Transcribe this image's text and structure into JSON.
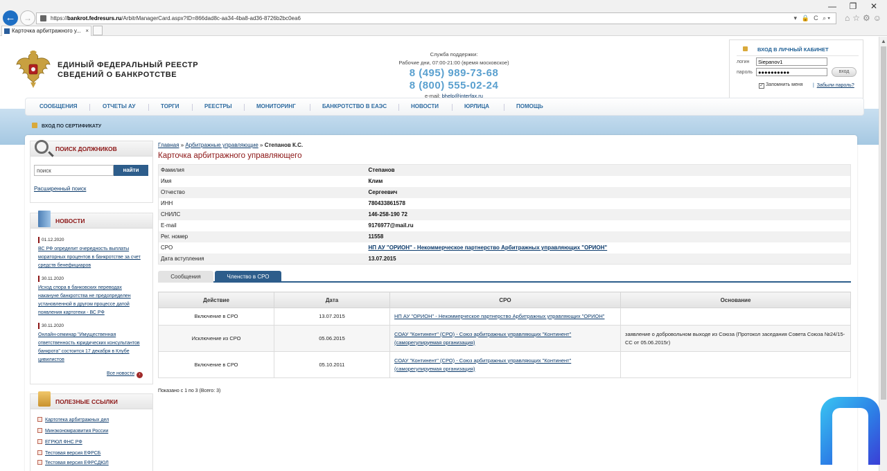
{
  "browser": {
    "url_prefix": "https://",
    "url_domain": "bankrot.fedresurs.ru",
    "url_path": "/ArbitrManagerCard.aspx?ID=866dad8c-aa34-4ba8-ad36-8726b2bc0ea6",
    "tab_title": "Карточка арбитражного у...",
    "tab_close": "×",
    "url_tools": "▾ 🔒 C  ⌕▾",
    "window_controls": [
      "—",
      "❐",
      "✕"
    ],
    "toolbar_icons": "⌂☆⚙☺"
  },
  "header": {
    "title_line1": "ЕДИНЫЙ ФЕДЕРАЛЬНЫЙ РЕЕСТР",
    "title_line2": "СВЕДЕНИЙ О БАНКРОТСТВЕ",
    "support_label": "Служба поддержки:",
    "support_hours": "Рабочие дни, 07:00-21:00 (время московское)",
    "phone1": "8 (495) 989-73-68",
    "phone2": "8 (800) 555-02-24",
    "email_label": "e-mail:",
    "email": "bhelp@interfax.ru"
  },
  "login": {
    "title": "ВХОД В ЛИЧНЫЙ КАБИНЕТ",
    "login_label": "логин",
    "login_value": "Siepanov1",
    "password_label": "пароль",
    "password_value": "●●●●●●●●●●",
    "button": "вход",
    "remember_mark": "✓",
    "remember": "Запомнить меня",
    "divider": "|",
    "forgot": "Забыли пароль?"
  },
  "menu": [
    "СООБЩЕНИЯ",
    "ОТЧЕТЫ АУ",
    "ТОРГИ",
    "РЕЕСТРЫ",
    "МОНИТОРИНГ",
    "БАНКРОТСТВО В ЕАЭС",
    "НОВОСТИ",
    "ЮРЛИЦА",
    "ПОМОЩЬ"
  ],
  "cert_login": "ВХОД ПО СЕРТИФИКАТУ",
  "search_widget": {
    "title": "ПОИСК ДОЛЖНИКОВ",
    "placeholder": "поиск",
    "button": "найти",
    "advanced": "Расширенный поиск"
  },
  "news_widget": {
    "title": "НОВОСТИ",
    "items": [
      {
        "date": "01.12.2020",
        "text": "ВС РФ определит очередность выплаты мораторных процентов в банкротстве за счет средств бенефициаров"
      },
      {
        "date": "30.11.2020",
        "text": "Исход спора в банковских переводах накануне банкротства не предопределен установленной в другом процессе датой появления картотеки - ВС РФ"
      },
      {
        "date": "30.11.2020",
        "text": "Онлайн-семинар \"Имущественная ответственность юридических консультантов банкрота\" состоится 17 декабря в Клубе цивилистов"
      }
    ],
    "all": "Все новости",
    "all_arrow": "›"
  },
  "links_widget": {
    "title": "ПОЛЕЗНЫЕ ССЫЛКИ",
    "items": [
      "Картотека арбитражных дел",
      "Минэкономразвития России",
      "ЕГРЮЛ ФНС РФ",
      "Тестовая версия ЕФРСБ",
      "Тестовая версия ЕФРСДЮЛ"
    ]
  },
  "breadcrumb": {
    "home": "Главная",
    "section": "Арбитражные управляющие",
    "sep": "»",
    "current": "Степанов К.С."
  },
  "card_title": "Карточка арбитражного управляющего",
  "info": [
    {
      "label": "Фамилия",
      "value": "Степанов"
    },
    {
      "label": "Имя",
      "value": "Клим"
    },
    {
      "label": "Отчество",
      "value": "Сергеевич"
    },
    {
      "label": "ИНН",
      "value": "780433861578"
    },
    {
      "label": "СНИЛС",
      "value": "146-258-190 72"
    },
    {
      "label": "E-mail",
      "value": "9176977@mail.ru"
    },
    {
      "label": "Рег. номер",
      "value": "11558"
    },
    {
      "label": "СРО",
      "value": "НП АУ \"ОРИОН\" - Некоммерческое партнерство Арбитражных управляющих \"ОРИОН\""
    },
    {
      "label": "Дата вступления",
      "value": "13.07.2015"
    }
  ],
  "tabs": [
    "Сообщения",
    "Членство в СРО"
  ],
  "membership": {
    "headers": [
      "Действие",
      "Дата",
      "СРО",
      "Основание"
    ],
    "rows": [
      {
        "action": "Включение в СРО",
        "date": "13.07.2015",
        "sro": "НП АУ \"ОРИОН\" - Некоммерческое партнерство Арбитражных управляющих \"ОРИОН\"",
        "reason": ""
      },
      {
        "action": "Исключение из СРО",
        "date": "05.06.2015",
        "sro": "СОАУ \"Континент\" (СРО) - Союз арбитражных управляющих \"Континент\" (саморегулируемая организация)",
        "reason": "заявление о добровольном выходе из Союза (Протокол заседания Совета Союза №24/15-СС от 05.06.2015г)"
      },
      {
        "action": "Включение в СРО",
        "date": "05.10.2011",
        "sro": "СОАУ \"Континент\" (СРО) - Союз арбитражных управляющих \"Континент\" (саморегулируемая организация)",
        "reason": ""
      }
    ],
    "summary": "Показано с 1 по 3 (Всего: 3)"
  }
}
